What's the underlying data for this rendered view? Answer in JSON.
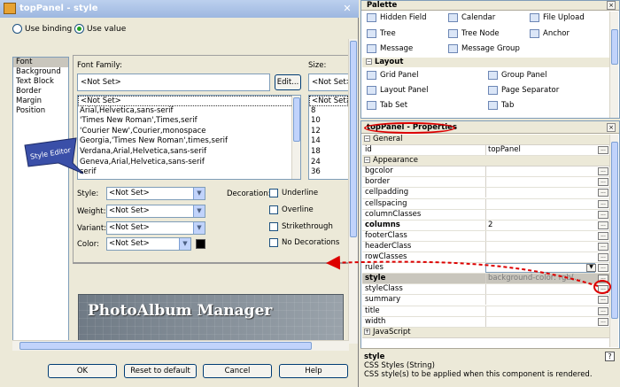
{
  "dialog": {
    "title": "topPanel - style",
    "close_glyph": "✕",
    "radio_use_binding": "Use binding",
    "radio_use_value": "Use value",
    "categories": [
      "Font",
      "Background",
      "Text Block",
      "Border",
      "Margin",
      "Position"
    ],
    "selected_category": "Font",
    "font_family_label": "Font Family:",
    "font_family_value": "<Not Set>",
    "edit_button": "Edit...",
    "font_list": [
      "<Not Set>",
      "Arial,Helvetica,sans-serif",
      "'Times New Roman',Times,serif",
      "'Courier New',Courier,monospace",
      "Georgia,'Times New Roman',times,serif",
      "Verdana,Arial,Helvetica,sans-serif",
      "Geneva,Arial,Helvetica,sans-serif",
      "serif"
    ],
    "size_label": "Size:",
    "size_value": "<Not Set>",
    "size_list": [
      "<Not Set>",
      "8",
      "10",
      "12",
      "14",
      "18",
      "24",
      "36"
    ],
    "style_label": "Style:",
    "style_value": "<Not Set>",
    "weight_label": "Weight:",
    "weight_value": "<Not Set>",
    "variant_label": "Variant:",
    "variant_value": "<Not Set>",
    "color_label": "Color:",
    "color_value": "<Not Set>",
    "color_swatch": "#000000",
    "decoration_label": "Decoration:",
    "decorations": [
      "Underline",
      "Overline",
      "Strikethrough",
      "No Decorations"
    ],
    "preview_banner_text": "PhotoAlbum Manager",
    "callout_text": "Style Editor",
    "buttons": {
      "ok": "OK",
      "reset": "Reset to default",
      "cancel": "Cancel",
      "help": "Help"
    }
  },
  "palette": {
    "title": "Palette",
    "close_glyph": "×",
    "items_top": [
      "Hidden Field",
      "Calendar",
      "File Upload",
      "Tree",
      "Tree Node",
      "Anchor",
      "Message",
      "Message Group"
    ],
    "layout_section": "Layout",
    "layout_items": [
      "Grid Panel",
      "Group Panel",
      "Layout Panel",
      "Page Separator",
      "Tab Set",
      "Tab"
    ]
  },
  "properties": {
    "title": "topPanel - Properties",
    "close_glyph": "×",
    "sections": {
      "general": "General",
      "appearance": "Appearance",
      "javascript": "JavaScript"
    },
    "general_rows": [
      {
        "name": "id",
        "value": "topPanel"
      }
    ],
    "appearance_rows": [
      {
        "name": "bgcolor",
        "value": ""
      },
      {
        "name": "border",
        "value": ""
      },
      {
        "name": "cellpadding",
        "value": ""
      },
      {
        "name": "cellspacing",
        "value": ""
      },
      {
        "name": "columnClasses",
        "value": ""
      },
      {
        "name": "columns",
        "value": "2"
      },
      {
        "name": "footerClass",
        "value": ""
      },
      {
        "name": "headerClass",
        "value": ""
      },
      {
        "name": "rowClasses",
        "value": ""
      },
      {
        "name": "rules",
        "value": ""
      },
      {
        "name": "style",
        "value": "background-color: rgb(..."
      },
      {
        "name": "styleClass",
        "value": ""
      },
      {
        "name": "summary",
        "value": ""
      },
      {
        "name": "title",
        "value": ""
      },
      {
        "name": "width",
        "value": ""
      }
    ],
    "help_name": "style",
    "help_type": "CSS Styles (String)",
    "help_desc": "CSS style(s) to be applied when this component is rendered.",
    "help_icon": "?"
  },
  "colors": {
    "annotation_red": "#dd0000",
    "callout_blue": "#3a4fa8",
    "title_bar": "#9db7e0"
  }
}
